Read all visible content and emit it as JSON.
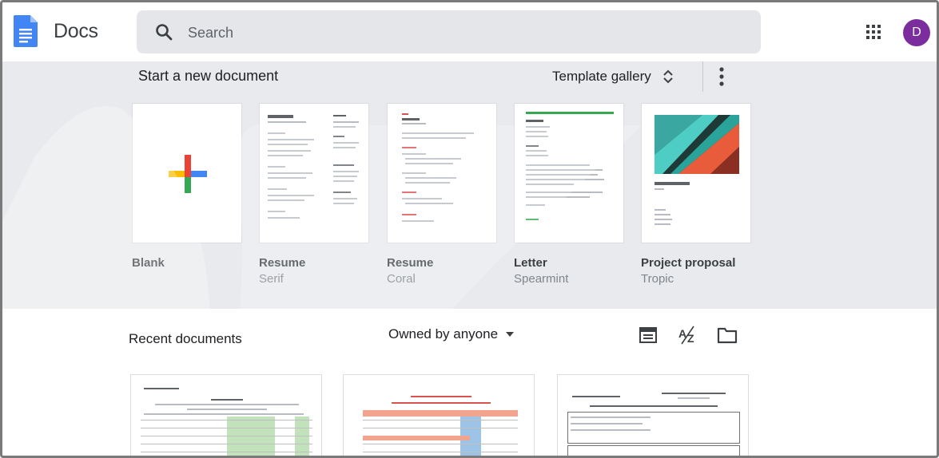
{
  "app": {
    "title": "Docs",
    "search_placeholder": "Search",
    "avatar_initial": "D",
    "brand_color": "#4285f4",
    "avatar_color": "#7b2d9e"
  },
  "templates": {
    "section_title": "Start a new document",
    "gallery_label": "Template gallery",
    "items": [
      {
        "name": "Blank",
        "subtitle": ""
      },
      {
        "name": "Resume",
        "subtitle": "Serif"
      },
      {
        "name": "Resume",
        "subtitle": "Coral"
      },
      {
        "name": "Letter",
        "subtitle": "Spearmint"
      },
      {
        "name": "Project proposal",
        "subtitle": "Tropic"
      }
    ]
  },
  "recent": {
    "section_title": "Recent documents",
    "owner_filter": "Owned by anyone"
  },
  "icons": {
    "docs": "docs-logo-icon",
    "search": "search-icon",
    "apps": "apps-grid-icon",
    "unfold": "unfold-more-icon",
    "more": "more-vert-icon",
    "list": "list-view-icon",
    "sort": "sort-az-icon",
    "folder": "folder-icon",
    "caret": "caret-down-icon"
  }
}
